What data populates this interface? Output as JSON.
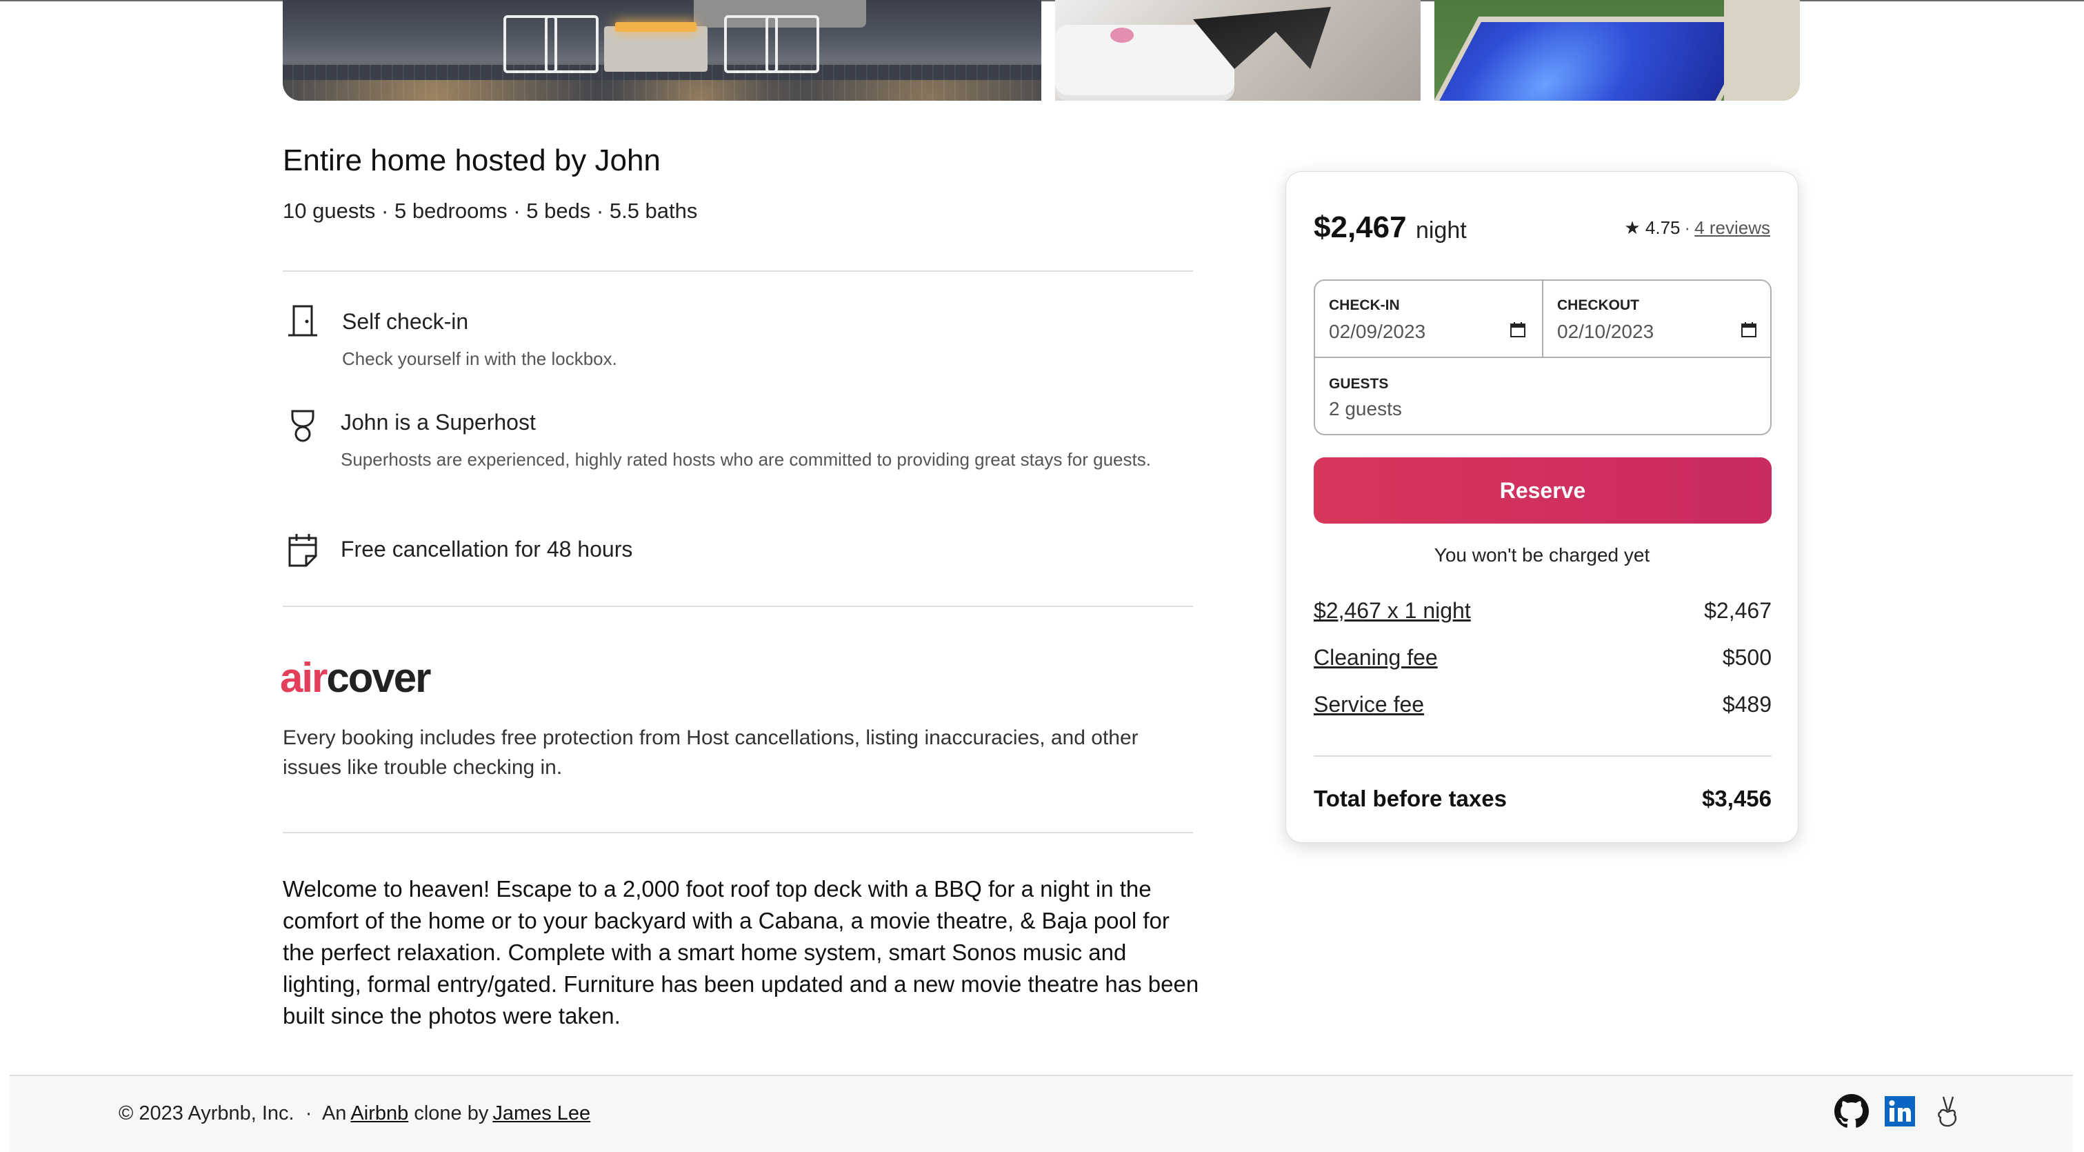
{
  "listing": {
    "title": "Entire home hosted by John",
    "summary": "10 guests · 5 bedrooms · 5 beds · 5.5 baths"
  },
  "features": [
    {
      "icon": "door-icon",
      "title": "Self check-in",
      "description": "Check yourself in with the lockbox."
    },
    {
      "icon": "medal-icon",
      "title": "John is a Superhost",
      "description": "Superhosts are experienced, highly rated hosts who are committed to providing great stays for guests."
    },
    {
      "icon": "calendar-icon",
      "title": "Free cancellation for 48 hours",
      "description": ""
    }
  ],
  "aircover": {
    "logo_air": "air",
    "logo_cover": "cover",
    "description": "Every booking includes free protection from Host cancellations, listing inaccuracies, and other issues like trouble checking in."
  },
  "description": "Welcome to heaven! Escape to a 2,000 foot roof top deck with a BBQ for a night in the comfort of the home or to your backyard with a Cabana, a movie theatre, & Baja pool for the perfect relaxation. Complete with a smart home system, smart Sonos music and lighting, formal entry/gated. Furniture has been updated and a new movie theatre has been built since the photos were taken.",
  "booking": {
    "price": "$2,467",
    "price_unit": "night",
    "rating_star": "★",
    "rating": "4.75",
    "rating_sep": "·",
    "reviews": "4 reviews",
    "checkin_label": "CHECK-IN",
    "checkin_value": "02/09/2023",
    "checkout_label": "CHECKOUT",
    "checkout_value": "02/10/2023",
    "guests_label": "GUESTS",
    "guests_value": "2 guests",
    "reserve_label": "Reserve",
    "not_charged": "You won't be charged yet",
    "fees": [
      {
        "label": "$2,467 x 1 night",
        "amount": "$2,467"
      },
      {
        "label": "Cleaning fee",
        "amount": "$500"
      },
      {
        "label": "Service fee",
        "amount": "$489"
      }
    ],
    "total_label": "Total before taxes",
    "total_amount": "$3,456"
  },
  "footer": {
    "copyright": "© 2023 Ayrbnb, Inc.",
    "sep": "·",
    "an": "An",
    "airbnb_link": "Airbnb",
    "clone_by": "clone by",
    "author_link": "James Lee",
    "icons": [
      "github-icon",
      "linkedin-icon",
      "angellist-icon"
    ]
  },
  "colors": {
    "brand": "#e33e5a",
    "reserve_start": "#d7375a",
    "reserve_end": "#c92a60",
    "text": "#222222"
  }
}
